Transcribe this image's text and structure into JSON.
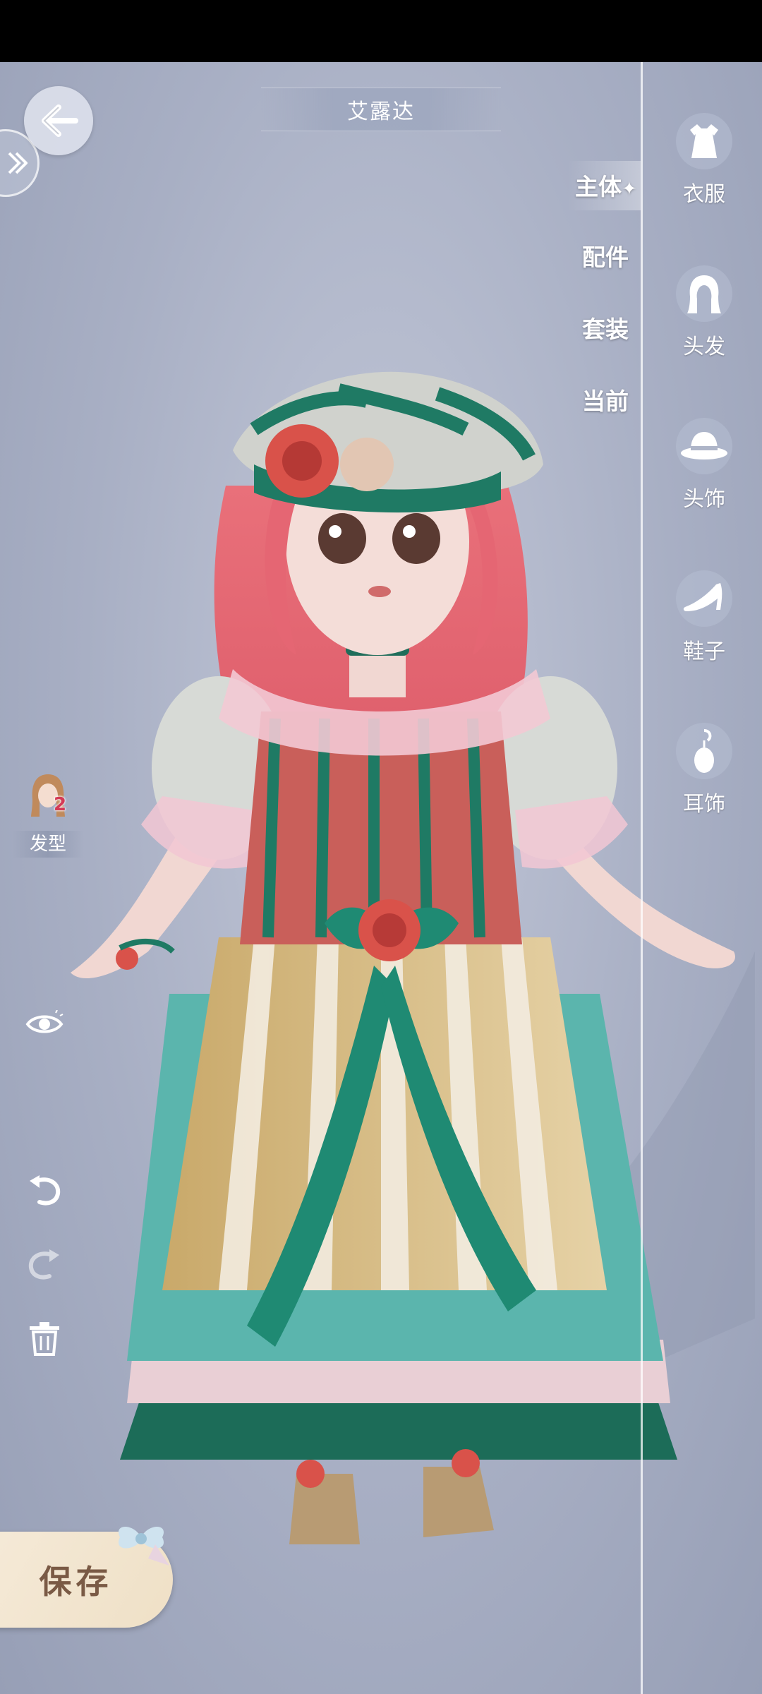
{
  "header": {
    "character_name": "艾露达"
  },
  "category_tabs": [
    {
      "label": "主体",
      "selected": true
    },
    {
      "label": "配件",
      "selected": false
    },
    {
      "label": "套装",
      "selected": false
    },
    {
      "label": "当前",
      "selected": false
    }
  ],
  "slots": [
    {
      "label": "衣服",
      "icon": "dress-icon"
    },
    {
      "label": "头发",
      "icon": "hair-icon"
    },
    {
      "label": "头饰",
      "icon": "hat-icon"
    },
    {
      "label": "鞋子",
      "icon": "high-heel-icon"
    },
    {
      "label": "耳饰",
      "icon": "earring-icon"
    }
  ],
  "hair_chip": {
    "label": "发型",
    "badge": "2"
  },
  "save": {
    "label": "保存"
  },
  "colors": {
    "accent_green": "#1f7a64",
    "rose": "#d9524a",
    "save_text": "#7a5a45"
  }
}
